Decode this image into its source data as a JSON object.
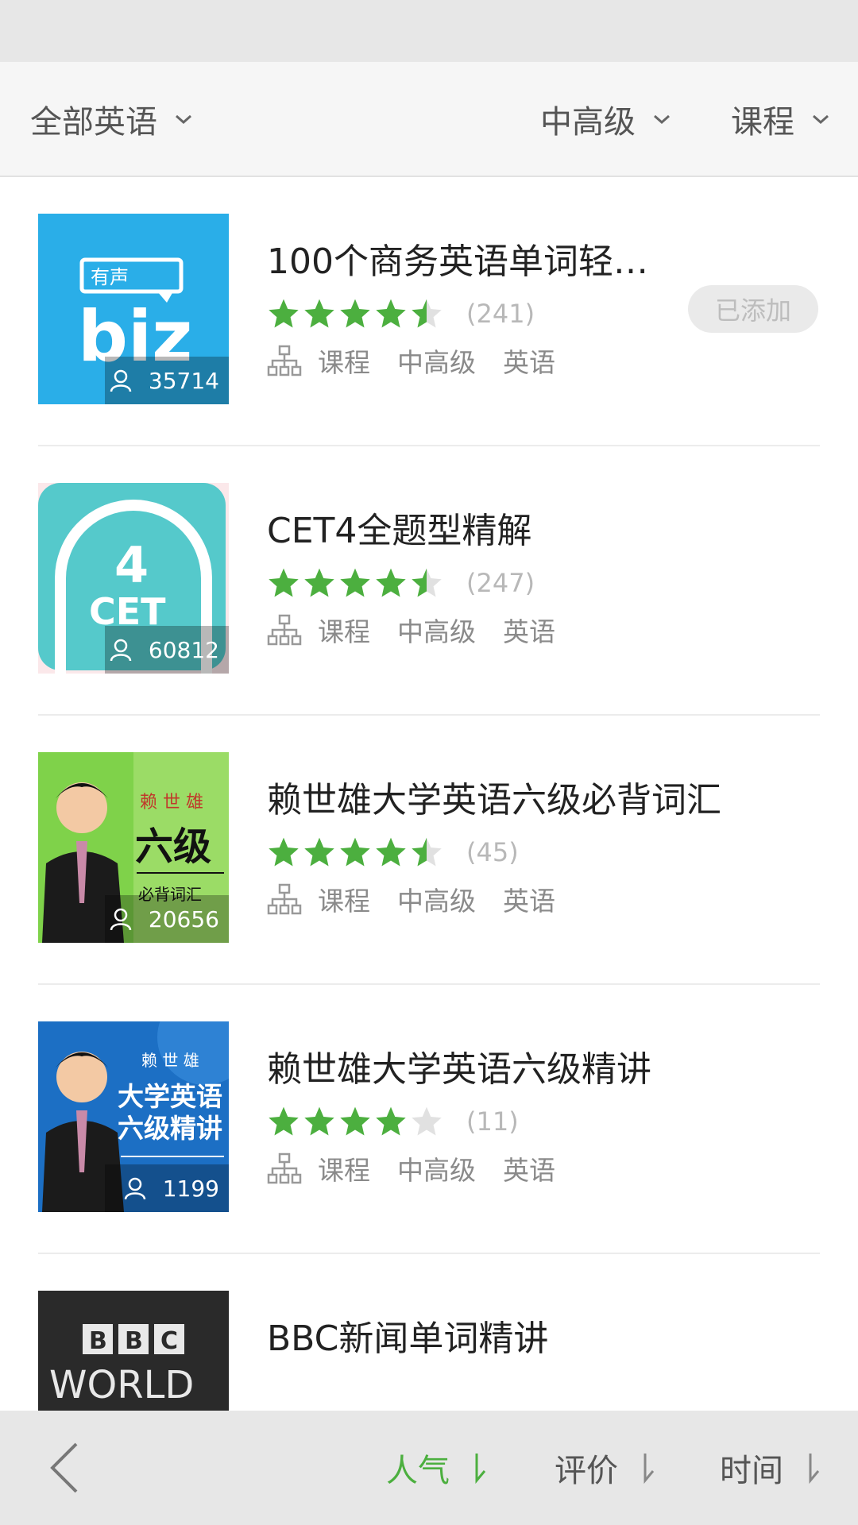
{
  "filters": {
    "language": "全部英语",
    "level": "中高级",
    "type": "课程"
  },
  "colors": {
    "accent": "#4caf3f",
    "star_empty": "#e1e1e1"
  },
  "courses": [
    {
      "title": "100个商务英语单词轻…",
      "rating": 4.5,
      "rating_count": "(241)",
      "learners": "35714",
      "tags": [
        "课程",
        "中高级",
        "英语"
      ],
      "added_label": "已添加",
      "thumb_text": [
        "有声",
        "biz"
      ]
    },
    {
      "title": "CET4全题型精解",
      "rating": 4.5,
      "rating_count": "(247)",
      "learners": "60812",
      "tags": [
        "课程",
        "中高级",
        "英语"
      ],
      "thumb_text": [
        "4",
        "CET"
      ]
    },
    {
      "title": "赖世雄大学英语六级必背词汇",
      "rating": 4.5,
      "rating_count": "(45)",
      "learners": "20656",
      "tags": [
        "课程",
        "中高级",
        "英语"
      ],
      "thumb_text": [
        "赖 世 雄",
        "六级",
        "必背词汇"
      ]
    },
    {
      "title": "赖世雄大学英语六级精讲",
      "rating": 4,
      "rating_count": "(11)",
      "learners": "1199",
      "tags": [
        "课程",
        "中高级",
        "英语"
      ],
      "thumb_text": [
        "赖 世 雄",
        "大学英语",
        "六级精讲"
      ]
    },
    {
      "title": "BBC新闻单词精讲",
      "thumb_text": [
        "B",
        "B",
        "C",
        "WORLD"
      ]
    }
  ],
  "sort": {
    "popularity": "人气",
    "rating": "评价",
    "time": "时间"
  }
}
